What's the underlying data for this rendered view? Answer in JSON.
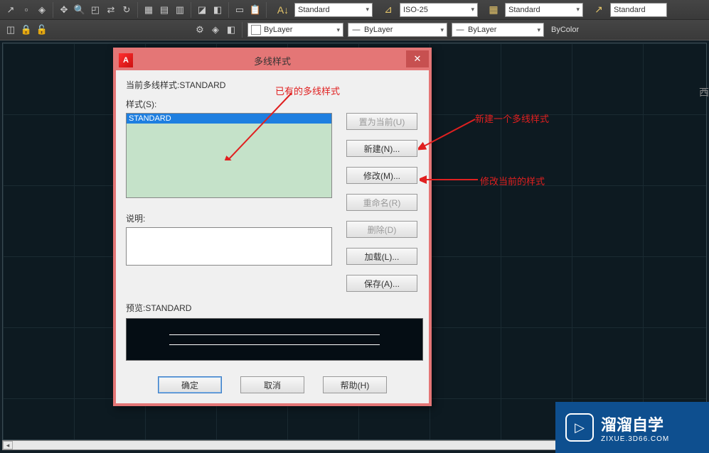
{
  "toolbar": {
    "textStyle": "Standard",
    "dimStyle": "ISO-25",
    "tableStyle": "Standard",
    "mleaderStyle": "Standard",
    "layerColor": "ByLayer",
    "linetype": "ByLayer",
    "lineweight": "ByLayer",
    "plotStyle": "ByColor"
  },
  "dialog": {
    "title": "多线样式",
    "currentLabel": "当前多线样式:STANDARD",
    "stylesLabel": "样式(S):",
    "selectedStyle": "STANDARD",
    "descLabel": "说明:",
    "previewLabel": "预览:STANDARD",
    "buttons": {
      "setCurrent": "置为当前(U)",
      "new": "新建(N)...",
      "modify": "修改(M)...",
      "rename": "重命名(R)",
      "delete": "删除(D)",
      "load": "加载(L)...",
      "save": "保存(A)...",
      "ok": "确定",
      "cancel": "取消",
      "help": "帮助(H)"
    }
  },
  "annotations": {
    "existing": "已有的多线样式",
    "new": "新建一个多线样式",
    "modify": "修改当前的样式"
  },
  "watermark": {
    "main": "溜溜自学",
    "sub": "ZIXUE.3D66.COM"
  },
  "sideText": "西"
}
